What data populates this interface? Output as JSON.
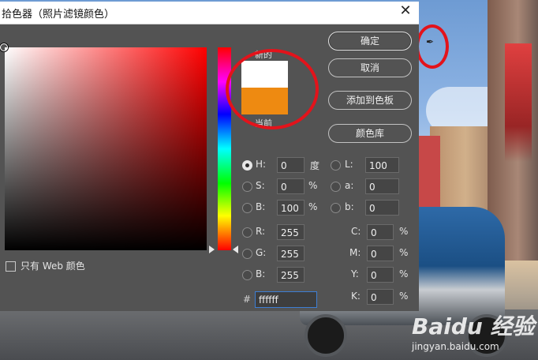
{
  "dialog": {
    "title": "拾色器（照片滤镜颜色）",
    "close_glyph": "✕"
  },
  "swatches": {
    "new_label": "新的",
    "current_label": "当前",
    "new_color": "#ffffff",
    "current_color": "#ee8a11"
  },
  "buttons": {
    "ok": "确定",
    "cancel": "取消",
    "add_to_swatches": "添加到色板",
    "color_libraries": "颜色库"
  },
  "only_web_colors": "只有 Web 颜色",
  "hsb": {
    "h": {
      "label": "H:",
      "value": "0",
      "unit": "度"
    },
    "s": {
      "label": "S:",
      "value": "0",
      "unit": "%"
    },
    "b": {
      "label": "B:",
      "value": "100",
      "unit": "%"
    }
  },
  "rgb": {
    "r": {
      "label": "R:",
      "value": "255"
    },
    "g": {
      "label": "G:",
      "value": "255"
    },
    "b": {
      "label": "B:",
      "value": "255"
    }
  },
  "lab": {
    "l": {
      "label": "L:",
      "value": "100"
    },
    "a": {
      "label": "a:",
      "value": "0"
    },
    "b": {
      "label": "b:",
      "value": "0"
    }
  },
  "cmyk": {
    "c": {
      "label": "C:",
      "value": "0",
      "unit": "%"
    },
    "m": {
      "label": "M:",
      "value": "0",
      "unit": "%"
    },
    "y": {
      "label": "Y:",
      "value": "0",
      "unit": "%"
    },
    "k": {
      "label": "K:",
      "value": "0",
      "unit": "%"
    }
  },
  "hex": {
    "label": "#",
    "value": "ffffff"
  },
  "watermark": {
    "logo": "Baidu 经验",
    "url": "jingyan.baidu.com"
  },
  "colors": {
    "dialog_bg": "#535353",
    "highlight_ring": "#e3131b",
    "hex_focus": "#3e7ed3"
  }
}
